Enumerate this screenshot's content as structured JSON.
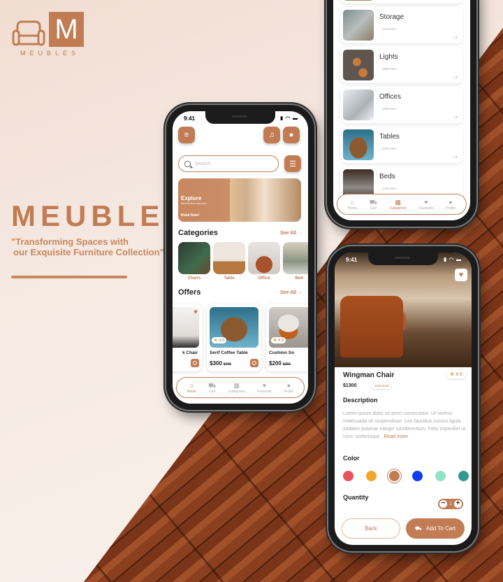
{
  "brand": {
    "logo_letter": "M",
    "logo_word": "MEUBLES",
    "title": "MEUBLES",
    "tagline_line1": "\"Transforming Spaces with",
    "tagline_line2": "our Exquisite Furniture Collection\"",
    "accent_color": "#c17c54"
  },
  "home": {
    "status_time": "9:41",
    "menu_icon": "menu-icon",
    "bell_icon": "bell-icon",
    "profile_icon": "user-icon",
    "search_placeholder": "Search",
    "banner": {
      "title": "Explore",
      "subtitle": "Best furniture near you !",
      "cta": "Book Now!"
    },
    "categories_title": "Categories",
    "categories_see_all": "See All →",
    "categories": [
      {
        "label": "Chairs"
      },
      {
        "label": "Table"
      },
      {
        "label": "Office"
      },
      {
        "label": "Bed"
      }
    ],
    "offers_title": "Offers",
    "offers_see_all": "See All →",
    "offers": [
      {
        "name": "k Chair",
        "price": "",
        "old_price": "$",
        "rating": ""
      },
      {
        "name": "Serif Coffee Table",
        "price": "$300",
        "old_price": "$400",
        "rating": "4.5"
      },
      {
        "name": "Cushion So",
        "price": "$200",
        "old_price": "$250",
        "rating": "4.5"
      }
    ]
  },
  "tabbar": {
    "items": [
      {
        "label": "Home",
        "icon": "home-icon"
      },
      {
        "label": "Cart",
        "icon": "cart-icon"
      },
      {
        "label": "Categories",
        "icon": "grid-icon"
      },
      {
        "label": "Favourite",
        "icon": "heart-icon"
      },
      {
        "label": "Profile",
        "icon": "user-icon"
      }
    ]
  },
  "category_list": [
    {
      "name": "",
      "count": ""
    },
    {
      "name": "Storage",
      "count": "2100 Item"
    },
    {
      "name": "Lights",
      "count": "1800 Item"
    },
    {
      "name": "Offices",
      "count": "1900 Item"
    },
    {
      "name": "Tables",
      "count": "2000 Item"
    },
    {
      "name": "Beds",
      "count": "1700 Item"
    }
  ],
  "product": {
    "status_time": "9:41",
    "name": "Wingman Chair",
    "rating": "4.5",
    "price": "$1300",
    "sold": "1526 Sold",
    "description_title": "Description",
    "description": "Lorem ipsum dolor sit amet consectetur. Ut viverra malesuada sit suspendisse. Leo faucibus cursus ligula sodales pulvinar integer condimentum. Felis imperdiet ut nunc scelerisque...",
    "read_more": "Read more",
    "color_title": "Color",
    "colors": [
      "#e8525a",
      "#f6a52b",
      "#c17c54",
      "#0b3ff0",
      "#8fe3c6",
      "#2f9a93"
    ],
    "selected_color_index": 2,
    "quantity_title": "Quantity",
    "quantity": "1",
    "back_label": "Back",
    "add_to_cart_label": "Add To Cart"
  }
}
